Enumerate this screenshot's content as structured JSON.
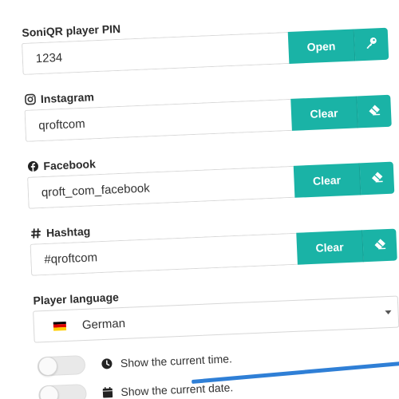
{
  "pin": {
    "label": "SoniQR player PIN",
    "value": "1234",
    "button_label": "Open",
    "button_icon": "key-icon"
  },
  "instagram": {
    "label": "Instagram",
    "icon": "instagram-icon",
    "value": "qroftcom",
    "button_label": "Clear",
    "button_icon": "eraser-icon"
  },
  "facebook": {
    "label": "Facebook",
    "icon": "facebook-icon",
    "value": "qroft_com_facebook",
    "button_label": "Clear",
    "button_icon": "eraser-icon"
  },
  "hashtag": {
    "label": "Hashtag",
    "icon": "hashtag-icon",
    "value": "#qroftcom",
    "button_label": "Clear",
    "button_icon": "eraser-icon"
  },
  "language": {
    "label": "Player language",
    "selected": "German",
    "flag_colors": [
      "#000000",
      "#dd0000",
      "#ffce00"
    ]
  },
  "toggles": [
    {
      "label": "Show the current time.",
      "icon": "clock-icon",
      "on": false
    },
    {
      "label": "Show the current date.",
      "icon": "calendar-icon",
      "on": false
    }
  ],
  "colors": {
    "accent": "#1ab3a6",
    "bottom_bar": "#2f7fd6"
  }
}
